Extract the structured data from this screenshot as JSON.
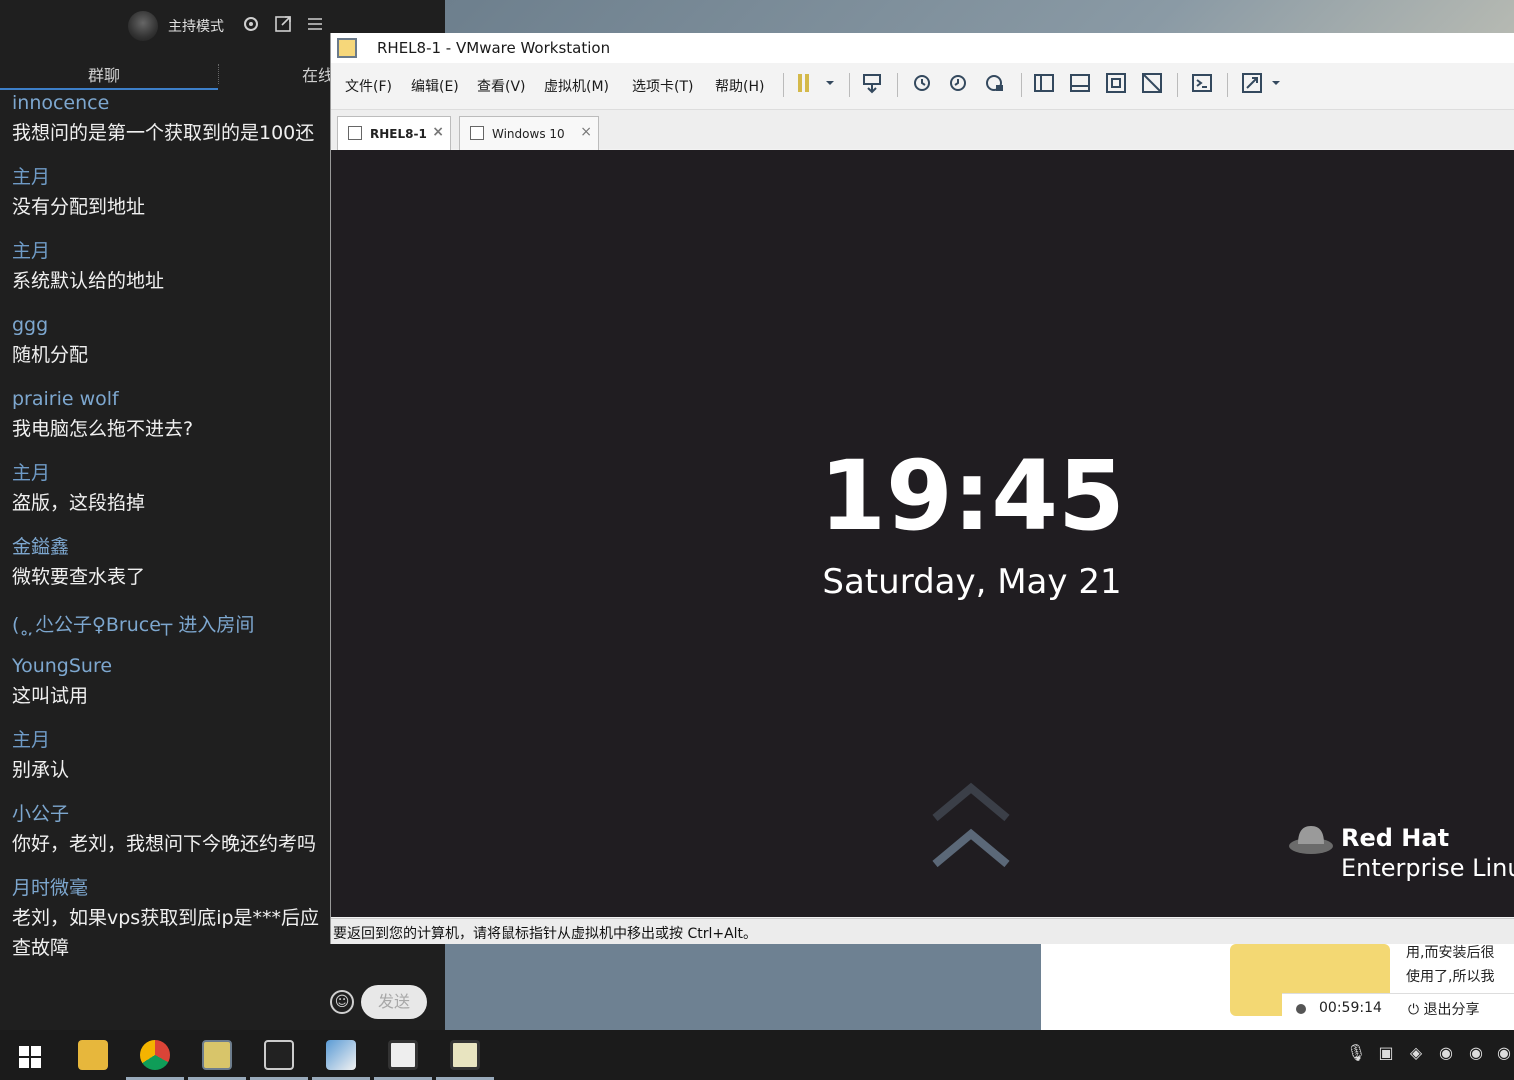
{
  "chat": {
    "mode_label": "主持模式",
    "tabs": [
      "群聊",
      "在线"
    ],
    "messages": [
      {
        "sender": "innocence",
        "text": "我想问的是第一个获取到的是100还"
      },
      {
        "sender": "主月",
        "text": "没有分配到地址"
      },
      {
        "sender": "主月",
        "text": "系统默认给的地址"
      },
      {
        "sender": "ggg",
        "text": "随机分配"
      },
      {
        "sender": "prairie wolf",
        "text": "我电脑怎么拖不进去?"
      },
      {
        "sender": "主月",
        "text": "盗版，这段掐掉"
      },
      {
        "sender": "金鎰鑫",
        "text": "微软要查水表了"
      },
      {
        "sender": "YoungSure",
        "text": "这叫试用"
      },
      {
        "sender": "主月",
        "text": "别承认"
      },
      {
        "sender": "小公子",
        "text": "你好，老刘，我想问下今晚还约考吗"
      },
      {
        "sender": "月时微毫",
        "text": "老刘，如果vps获取到底ip是***后应",
        "text2": "查故障"
      }
    ],
    "system_event": "(˳ ̦̦̦尐公子♀Bruce┬  进入房间",
    "send_label": "发送"
  },
  "vmware": {
    "title": "RHEL8-1 - VMware Workstation",
    "menu": [
      "文件(F)",
      "编辑(E)",
      "查看(V)",
      "虚拟机(M)",
      "选项卡(T)",
      "帮助(H)"
    ],
    "tabs": [
      {
        "label": "RHEL8-1",
        "active": true
      },
      {
        "label": "Windows 10",
        "active": false
      }
    ],
    "status_text": "要返回到您的计算机，请将鼠标指针从虚拟机中移出或按 Ctrl+Alt。"
  },
  "lockscreen": {
    "time": "19:45",
    "date": "Saturday, May 21",
    "brand": "Red Hat",
    "product": "Enterprise Linu"
  },
  "share": {
    "text_line1": "用,而安装后很",
    "text_line2": "使用了,所以我",
    "timer": "00:59:14",
    "exit_label": "退出分享"
  },
  "taskbar": {
    "apps": [
      "start",
      "file-explorer",
      "chrome",
      "vmware",
      "media-player",
      "paint",
      "terminal-app-1",
      "terminal-app-2"
    ]
  },
  "colors": {
    "chat_bg": "#1f1f1f",
    "chat_name": "#7da7cf",
    "vm_screen_bg": "#201d21",
    "share_card": "#f3d873",
    "accent_blue": "#3d7fc9"
  }
}
